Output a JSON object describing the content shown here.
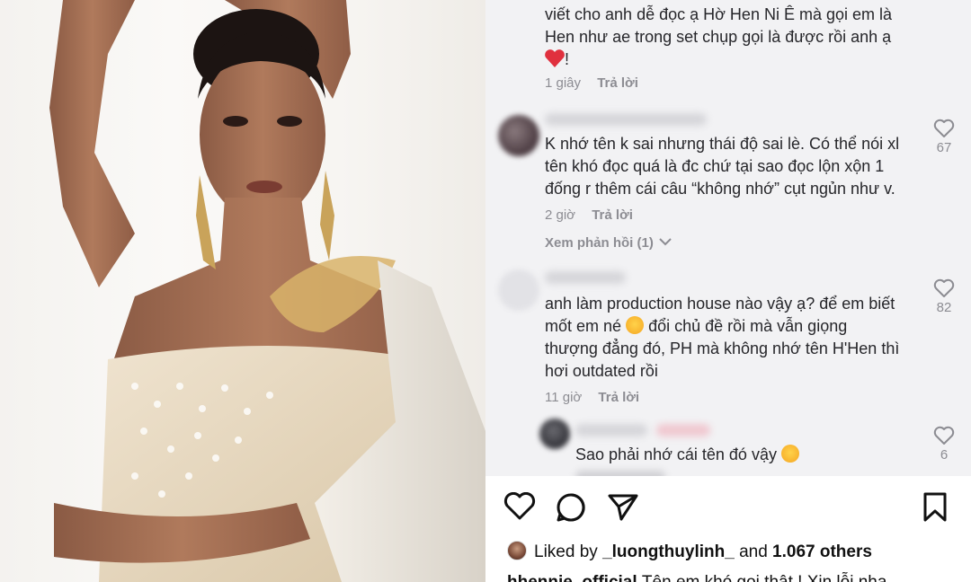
{
  "comments": [
    {
      "text_lines": [
        "viết cho anh dễ đọc ạ Hờ Hen Ni Ê mà gọi em là",
        "Hen như ae trong set chụp gọi là được rồi anh ạ",
        "!"
      ],
      "time": "1 giây",
      "reply_label": "Trả lời"
    },
    {
      "text_lines": [
        "K nhớ tên k sai nhưng thái độ sai lè. Có thể nói xl",
        "tên khó đọc quá là đc chứ tại sao đọc lộn xộn 1",
        "đống r thêm cái câu “không nhớ” cụt ngủn như v."
      ],
      "time": "2 giờ",
      "reply_label": "Trả lời",
      "view_replies": "Xem phản hồi (1)",
      "likes": "67"
    },
    {
      "text_lines": [
        "anh làm production house nào vậy ạ? để em biết",
        "mốt em né",
        "đổi chủ đề rồi mà vẫn giọng",
        "thượng đẳng đó, PH mà không nhớ tên H'Hen thì",
        "hơi outdated rồi"
      ],
      "time": "11 giờ",
      "reply_label": "Trả lời",
      "likes": "82"
    },
    {
      "text": "Sao phải nhớ cái tên đó vậy",
      "likes": "6"
    }
  ],
  "post": {
    "liked_prefix": "Liked by",
    "liked_user": "_luongthuylinh_",
    "liked_and": "and",
    "liked_others": "1.067 others",
    "caption_user": "hhennie_official",
    "caption_text": "Tên em khó gọi thật ! Xin lỗi nha"
  },
  "icons": {
    "heart": "heart-outline-icon",
    "comment": "comment-bubble-icon",
    "share": "paper-plane-icon",
    "save": "bookmark-icon"
  },
  "colors": {
    "comment_bg": "#f2f2f4",
    "text": "#26262a",
    "muted": "#8c8c92",
    "heart_emoji": "#e0303e"
  }
}
